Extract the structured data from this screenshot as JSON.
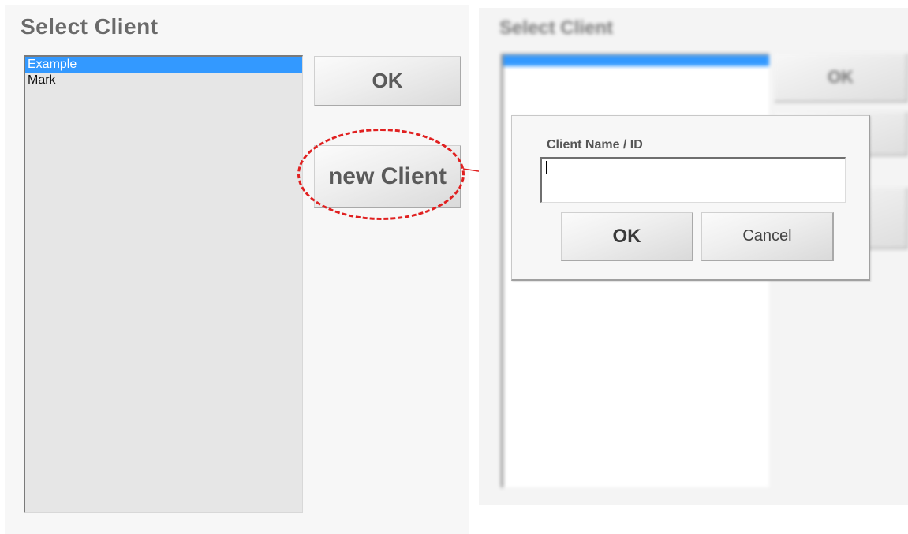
{
  "left_window": {
    "title": "Select Client",
    "client_list": [
      "Example",
      "Mark"
    ],
    "selected_index": 0,
    "ok_label": "OK",
    "new_client_label": "new Client"
  },
  "right_window": {
    "title": "Select Client",
    "ok_label": "OK"
  },
  "dialog": {
    "label": "Client Name / ID",
    "input_value": "",
    "ok_label": "OK",
    "cancel_label": "Cancel"
  },
  "colors": {
    "selection": "#3399ff",
    "highlight": "#e02020"
  }
}
